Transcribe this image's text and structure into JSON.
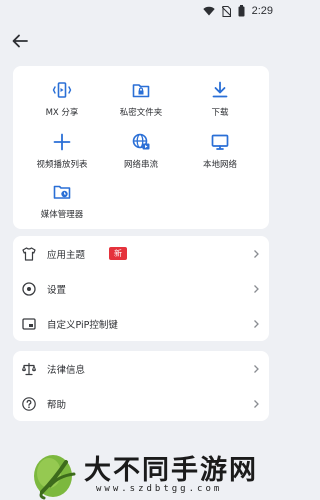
{
  "status": {
    "time": "2:29"
  },
  "grid": [
    {
      "label": "MX 分享",
      "icon": "share-icon"
    },
    {
      "label": "私密文件夹",
      "icon": "lock-folder-icon"
    },
    {
      "label": "下载",
      "icon": "download-icon"
    },
    {
      "label": "视频播放列表",
      "icon": "plus-icon"
    },
    {
      "label": "网络串流",
      "icon": "globe-stream-icon"
    },
    {
      "label": "本地网络",
      "icon": "monitor-icon"
    },
    {
      "label": "媒体管理器",
      "icon": "media-manager-icon"
    }
  ],
  "menu1": [
    {
      "label": "应用主题",
      "icon": "shirt-icon",
      "badge": "新"
    },
    {
      "label": "设置",
      "icon": "settings-icon"
    },
    {
      "label": "自定义PiP控制键",
      "icon": "pip-icon"
    }
  ],
  "menu2": [
    {
      "label": "法律信息",
      "icon": "scale-icon"
    },
    {
      "label": "帮助",
      "icon": "help-icon"
    }
  ],
  "watermark": {
    "title": "大不同手游网",
    "url": "www.szdbtgg.com"
  },
  "colors": {
    "accent": "#2a6fd6",
    "badge": "#e5323c",
    "background": "#eef0f4"
  }
}
